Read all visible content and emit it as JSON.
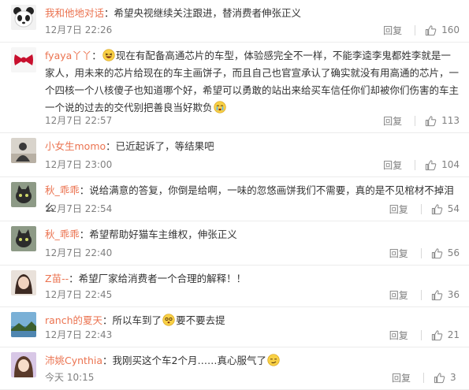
{
  "comments": [
    {
      "user": "我和他地对话",
      "segments": [
        {
          "t": "text",
          "v": "希望央视继续关注跟进，替消费者伸张正义"
        }
      ],
      "date": "12月7日 22:26",
      "reply": "回复",
      "likes": "160",
      "avatar": "panda-avatar",
      "avatar_colors": [
        "#f2f2f2",
        "#222222"
      ]
    },
    {
      "user": "fyaya丫丫",
      "segments": [
        {
          "t": "emoji",
          "v": "laughing-emoji"
        },
        {
          "t": "text",
          "v": "现在有配备高通芯片的车型，体验感完全不一样，不能李逵李鬼都姓李就是一家人，用未来的芯片给现在的车主画饼子，而且自己也官宣承认了确实就没有用高通的芯片，一个四核一个八核傻子也知道哪个好，希望可以勇敢的站出来给买车信任你们却被你们伤害的车主一个说的过去的交代别把善良当好欺负"
        },
        {
          "t": "emoji",
          "v": "crying-emoji"
        }
      ],
      "date": "12月7日 22:57",
      "reply": "回复",
      "likes": "113",
      "avatar": "red-bow-avatar",
      "avatar_colors": [
        "#f6f6f6",
        "#c8102e"
      ]
    },
    {
      "user": "小女生momo",
      "segments": [
        {
          "t": "text",
          "v": "已近起诉了，等结果吧"
        }
      ],
      "date": "12月7日 23:00",
      "reply": "回复",
      "likes": "104",
      "avatar": "photo-avatar",
      "avatar_colors": [
        "#d9d4cc",
        "#3a3a3a"
      ]
    },
    {
      "user": "秋_乖乖",
      "segments": [
        {
          "t": "text",
          "v": "说给满意的答复，你倒是给啊，一味的忽悠画饼我们不需要，真的是不见棺材不掉泪么"
        }
      ],
      "date": "12月7日 22:54",
      "reply": "回复",
      "likes": "54",
      "avatar": "cat-avatar",
      "avatar_colors": [
        "#8d9a86",
        "#2b2b2b"
      ]
    },
    {
      "user": "秋_乖乖",
      "segments": [
        {
          "t": "text",
          "v": "希望帮助好猫车主维权，伸张正义"
        }
      ],
      "date": "12月7日 22:40",
      "reply": "回复",
      "likes": "56",
      "avatar": "cat-avatar",
      "avatar_colors": [
        "#8d9a86",
        "#2b2b2b"
      ]
    },
    {
      "user": "Z苗--",
      "segments": [
        {
          "t": "text",
          "v": "希望厂家给消费者一个合理的解释！！"
        }
      ],
      "date": "12月7日 22:45",
      "reply": "回复",
      "likes": "36",
      "avatar": "person-avatar",
      "avatar_colors": [
        "#e9e1da",
        "#3d2a22"
      ]
    },
    {
      "user": "ranch的夏天",
      "segments": [
        {
          "t": "text",
          "v": "所以车到了"
        },
        {
          "t": "emoji",
          "v": "dizzy-emoji"
        },
        {
          "t": "text",
          "v": "要不要去提"
        }
      ],
      "date": "12月7日 22:43",
      "reply": "回复",
      "likes": "21",
      "avatar": "landscape-avatar",
      "avatar_colors": [
        "#7ab0d6",
        "#3c5f2e"
      ]
    },
    {
      "user": "沛姚Cynthia",
      "segments": [
        {
          "t": "text",
          "v": "我刚买这个车2个月……真心服气了"
        },
        {
          "t": "emoji",
          "v": "smirk-emoji"
        }
      ],
      "date": "今天 10:15",
      "reply": "回复",
      "likes": "3",
      "avatar": "girl-avatar",
      "avatar_colors": [
        "#d8c7e6",
        "#5a3a2a"
      ]
    }
  ]
}
